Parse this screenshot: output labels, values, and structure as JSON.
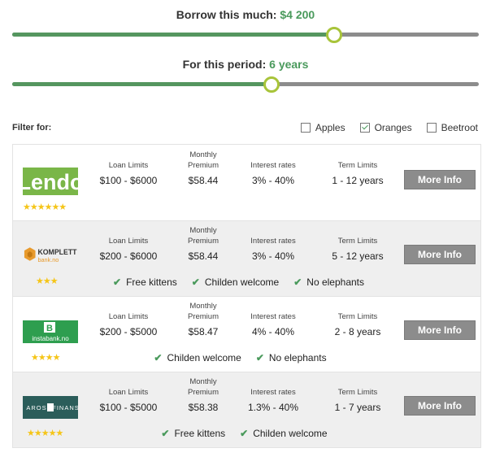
{
  "borrow": {
    "label": "Borrow this much:",
    "value": "$4 200",
    "fill_fraction": 0.69
  },
  "period": {
    "label": "For this period:",
    "value": "6 years",
    "fill_fraction": 0.555
  },
  "filter": {
    "label": "Filter for:",
    "options": [
      {
        "label": "Apples",
        "checked": false
      },
      {
        "label": "Oranges",
        "checked": true
      },
      {
        "label": "Beetroot",
        "checked": false
      }
    ]
  },
  "columns": {
    "loan_limits": "Loan Limits",
    "monthly": "Monthly",
    "premium": "Premium",
    "interest": "Interest rates",
    "term": "Term Limits"
  },
  "button_label": "More Info",
  "lenders": [
    {
      "name": "Lendo",
      "stars": "★★★★★★",
      "loan": "$100 - $6000",
      "monthly": "$58.44",
      "interest": "3% - 40%",
      "term": "1 - 12 years",
      "features": []
    },
    {
      "name": "KOMPLETT",
      "sub": "bank.no",
      "stars": "★★★",
      "loan": "$200 - $6000",
      "monthly": "$58.44",
      "interest": "3% - 40%",
      "term": "5 - 12 years",
      "features": [
        "Free kittens",
        "Childen welcome",
        "No elephants"
      ]
    },
    {
      "name": "instabank.no",
      "mark": "B",
      "stars": "★★★★",
      "loan": "$200 - $5000",
      "monthly": "$58.47",
      "interest": "4% - 40%",
      "term": "2 - 8 years",
      "features": [
        "Childen welcome",
        "No elephants"
      ]
    },
    {
      "name": "AROS",
      "sub": "FINANS",
      "stars": "★★★★★",
      "loan": "$100 - $5000",
      "monthly": "$58.38",
      "interest": "1.3% - 40%",
      "term": "1 - 7 years",
      "features": [
        "Free kittens",
        "Childen welcome"
      ]
    }
  ],
  "colors": {
    "accent": "#4a9a5c",
    "track": "#8c8c8c",
    "thumb_ring": "#a8c43a",
    "lendo_green": "#7ab648",
    "instabank_green": "#2e9e4f",
    "aros_teal": "#2b5d5a",
    "komplett_orange": "#e89a2c"
  }
}
